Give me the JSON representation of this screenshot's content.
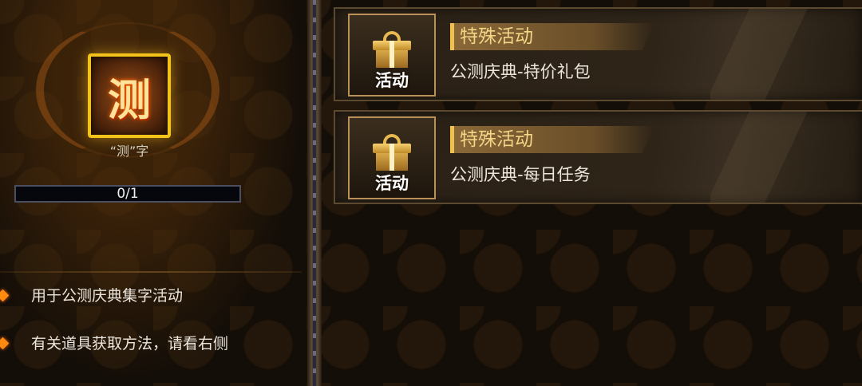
{
  "item": {
    "glyph": "测",
    "name": "“测”字",
    "progress_text": "0/1",
    "progress_fraction": 0
  },
  "description": [
    {
      "text": "用于公测庆典集字活动"
    },
    {
      "text": "有关道具获取方法，请看右侧"
    }
  ],
  "activities": [
    {
      "icon": "gift-icon",
      "icon_label": "活动",
      "title": "特殊活动",
      "subtitle": "公测庆典-特价礼包"
    },
    {
      "icon": "gift-icon",
      "icon_label": "活动",
      "title": "特殊活动",
      "subtitle": "公测庆典-每日任务"
    }
  ],
  "colors": {
    "accent_gold": "#f2c318",
    "bullet_orange": "#ff8a10",
    "title_gold": "#f4d686"
  }
}
